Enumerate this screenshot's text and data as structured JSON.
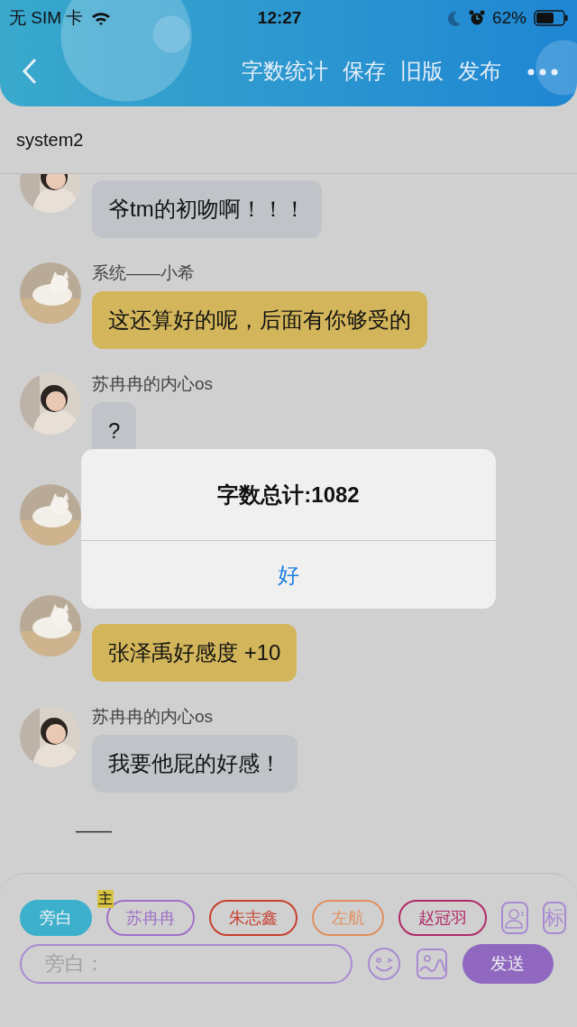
{
  "status_bar": {
    "carrier": "无 SIM 卡",
    "time": "12:27",
    "battery": "62%"
  },
  "header": {
    "actions": [
      "字数统计",
      "保存",
      "旧版",
      "发布"
    ]
  },
  "title": "system2",
  "messages": [
    {
      "kind": "picture",
      "bubble": "爷tm的初吻啊！！！",
      "color": "#c0c3c8"
    },
    {
      "kind": "picture",
      "name": "系统——小希",
      "bubble": "这还算好的呢，后面有你够受的",
      "color": "#d3b65b"
    },
    {
      "kind": "picture",
      "name": "苏冉冉的内心os",
      "bubble": "?",
      "color": "#c0c3c8"
    },
    {
      "kind": "picture"
    },
    {
      "kind": "picture",
      "bubble": "张泽禹好感度 +10",
      "color": "#d3b65b"
    },
    {
      "kind": "picture",
      "name": "苏冉冉的内心os",
      "bubble": "我要他屁的好感！",
      "color": "#c0c3c8"
    }
  ],
  "trailing_text": "——",
  "alert": {
    "title": "字数总计:1082",
    "button": "好"
  },
  "roles": [
    {
      "label": "旁白",
      "selected": true,
      "color": "#3cb0cc"
    },
    {
      "label": "苏冉冉",
      "selected": false,
      "color": "#a070c8",
      "tag": "主"
    },
    {
      "label": "朱志鑫",
      "selected": false,
      "color": "#c8402e"
    },
    {
      "label": "左航",
      "selected": false,
      "color": "#e09060"
    },
    {
      "label": "赵冠羽",
      "selected": false,
      "color": "#b02a68"
    }
  ],
  "mark_button": "标",
  "input": {
    "placeholder": "旁白："
  },
  "send_button": "发送"
}
